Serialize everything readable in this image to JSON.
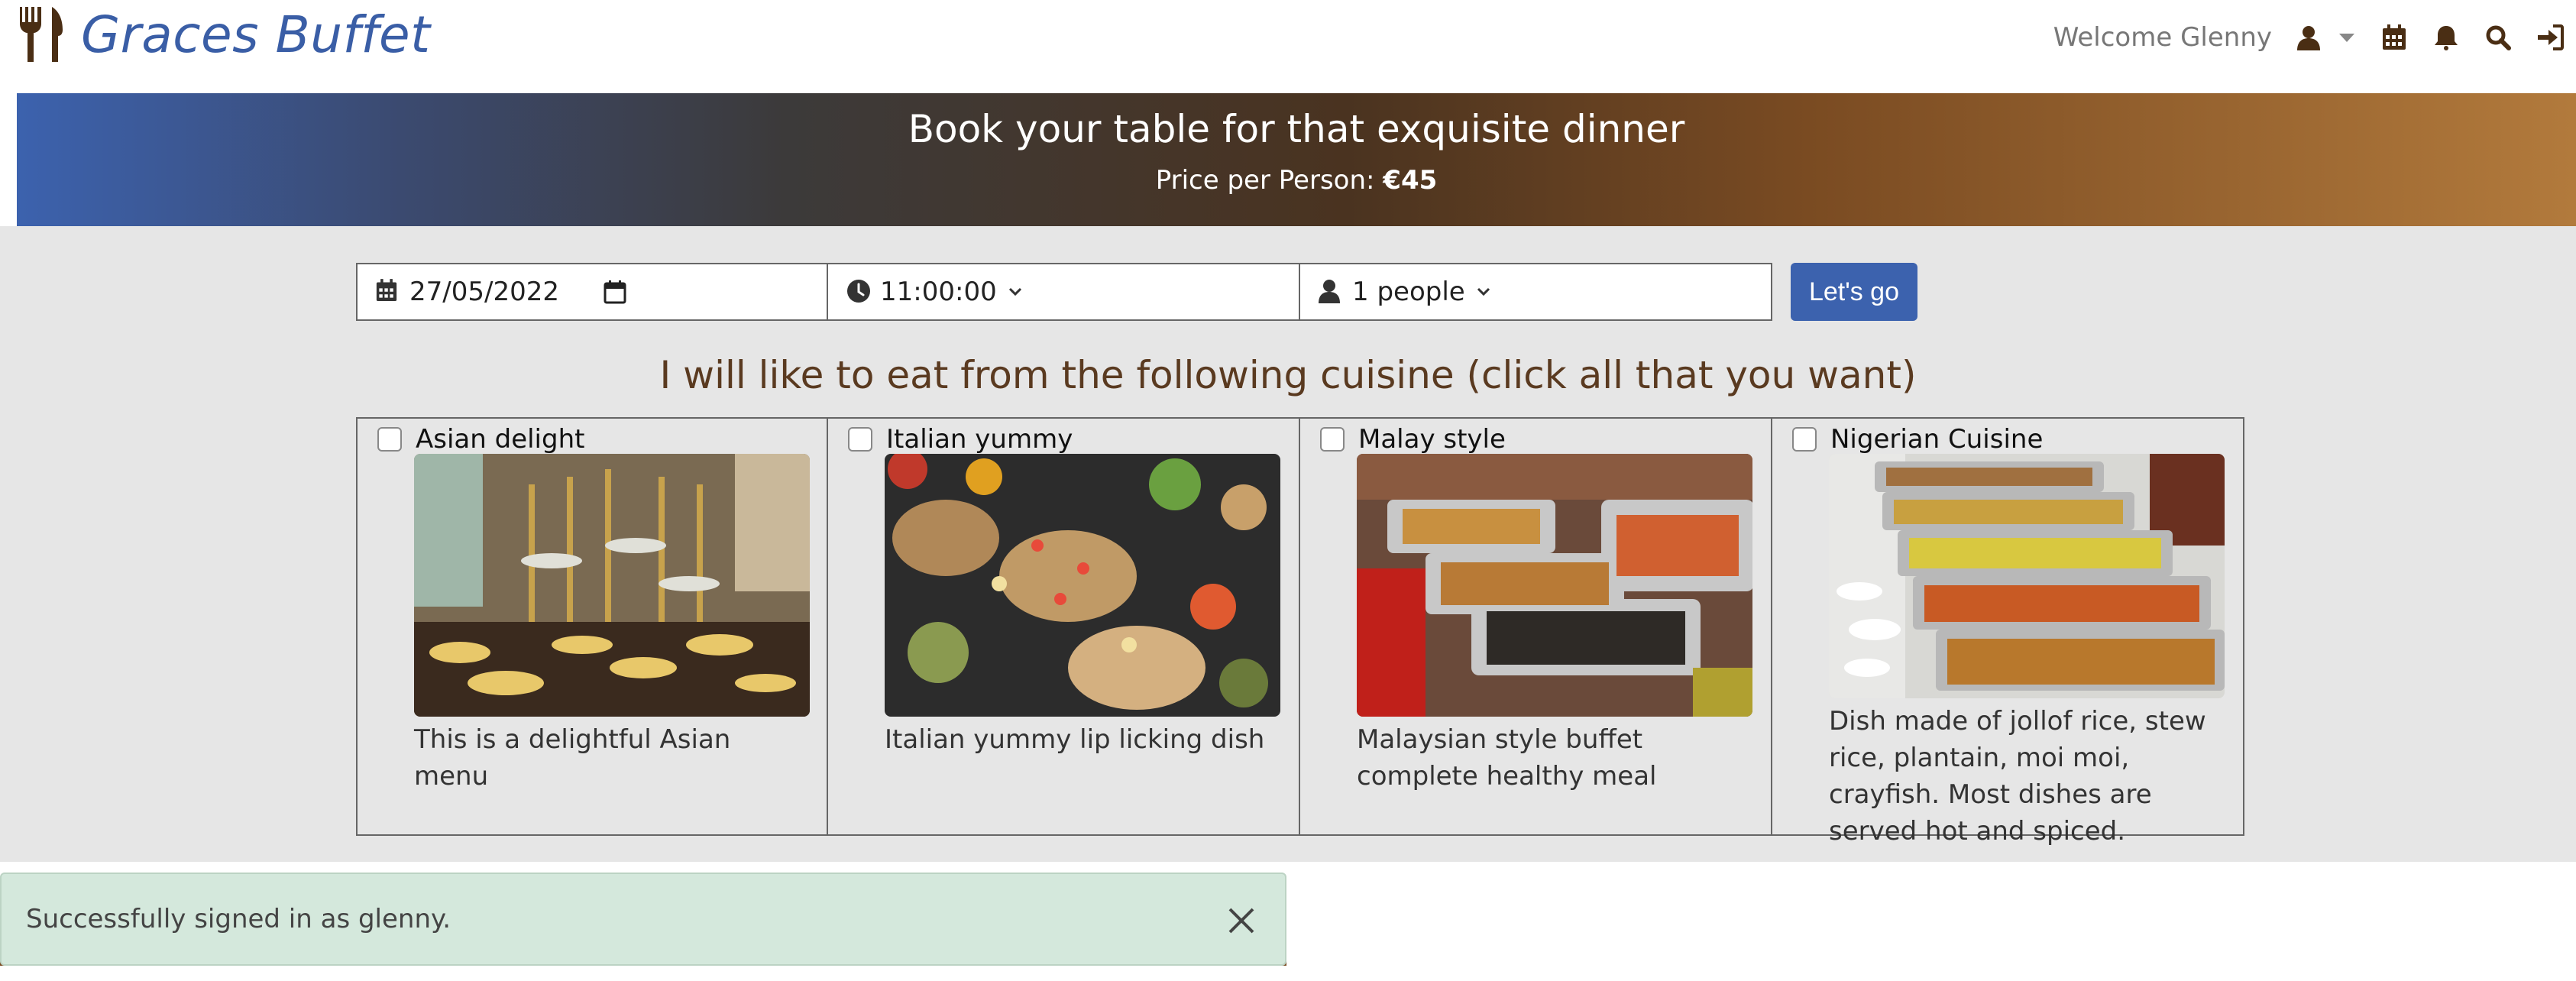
{
  "header": {
    "brand_title": "Graces Buffet",
    "brand_icon": "fork-knife-icon",
    "welcome_text": "Welcome Glenny",
    "icons": [
      "user-icon",
      "calendar-icon",
      "bell-icon",
      "search-icon",
      "sign-in-icon"
    ]
  },
  "hero": {
    "title": "Book your table for that exquisite dinner",
    "price_label": "Price per Person:",
    "price_value": "€45"
  },
  "booking": {
    "date_value": "27/05/2022",
    "time_value": "11:00:00",
    "people_value": "1 people",
    "submit_label": "Let's go"
  },
  "cuisine": {
    "heading": "I will like to eat from the following cuisine (click all that you want)",
    "items": [
      {
        "title": "Asian delight",
        "description": "This is a delightful Asian menu",
        "checked": false
      },
      {
        "title": "Italian yummy",
        "description": "Italian yummy lip licking dish",
        "checked": false
      },
      {
        "title": "Malay style",
        "description": "Malaysian style buffet complete healthy meal",
        "checked": false
      },
      {
        "title": "Nigerian Cuisine",
        "description": "Dish made of jollof rice, stew rice, plantain, moi moi, crayfish. Most dishes are served hot and spiced.",
        "checked": false
      }
    ]
  },
  "toast": {
    "message": "Successfully signed in as glenny."
  },
  "colors": {
    "brand": "#3a5ea6",
    "button": "#3c62ae",
    "heading": "#5a3a20",
    "toast_bg": "#d4e8dc"
  }
}
